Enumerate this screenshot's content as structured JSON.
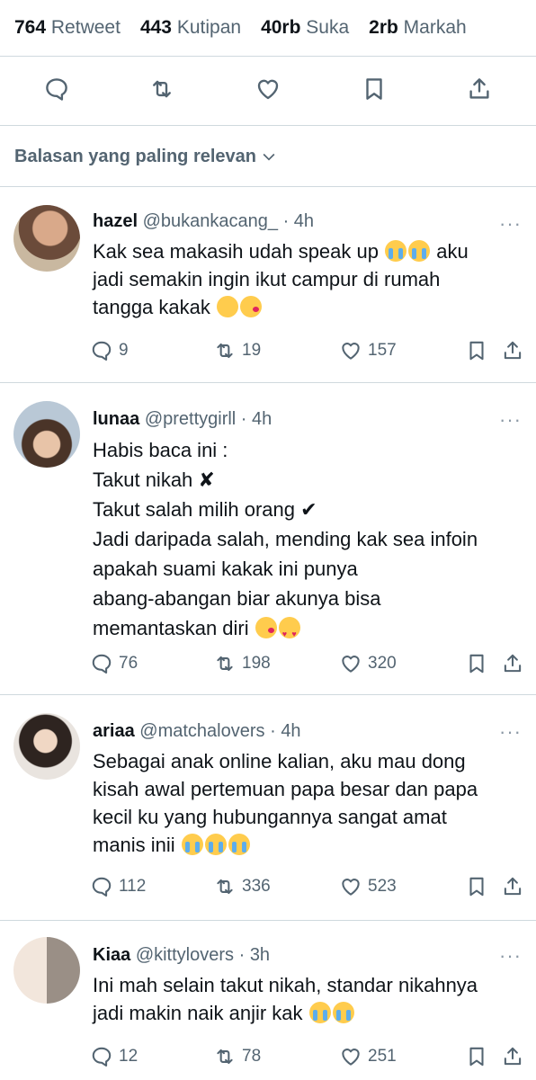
{
  "stats": {
    "retweets": {
      "count": "764",
      "label": "Retweet"
    },
    "quotes": {
      "count": "443",
      "label": "Kutipan"
    },
    "likes": {
      "count": "40rb",
      "label": "Suka"
    },
    "bookmarks": {
      "count": "2rb",
      "label": "Markah"
    }
  },
  "sort_label": "Balasan yang paling relevan",
  "replies": [
    {
      "name": "hazel",
      "handle": "@bukankacang_",
      "time": "4h",
      "lines": [
        "Kak sea makasih udah speak up",
        "jadi semakin ingin ikut campur di rumah",
        "tangga kakak"
      ],
      "line1_tail": "aku",
      "reply_count": "9",
      "retweet_count": "19",
      "like_count": "157"
    },
    {
      "name": "lunaa",
      "handle": "@prettygirll",
      "time": "4h",
      "lines": [
        "Habis baca ini :",
        "Takut nikah ✘",
        "Takut salah milih orang ✔",
        "Jadi daripada salah, mending kak sea infoin",
        "apakah suami kakak ini punya",
        "abang-abangan biar akunya bisa",
        "memantaskan diri"
      ],
      "reply_count": "76",
      "retweet_count": "198",
      "like_count": "320"
    },
    {
      "name": "ariaa",
      "handle": "@matchalovers",
      "time": "4h",
      "lines": [
        "Sebagai anak online kalian, aku mau dong",
        "kisah awal pertemuan papa besar dan papa",
        "kecil ku yang hubungannya sangat amat",
        "manis inii"
      ],
      "reply_count": "112",
      "retweet_count": "336",
      "like_count": "523"
    },
    {
      "name": "Kiaa",
      "handle": "@kittylovers",
      "time": "3h",
      "lines": [
        "Ini mah selain takut nikah, standar nikahnya",
        "jadi makin naik anjir kak"
      ],
      "reply_count": "12",
      "retweet_count": "78",
      "like_count": "251"
    }
  ],
  "icons": [
    "reply-icon",
    "retweet-icon",
    "like-icon",
    "bookmark-icon",
    "share-icon",
    "more-icon",
    "chevron-down-icon"
  ]
}
